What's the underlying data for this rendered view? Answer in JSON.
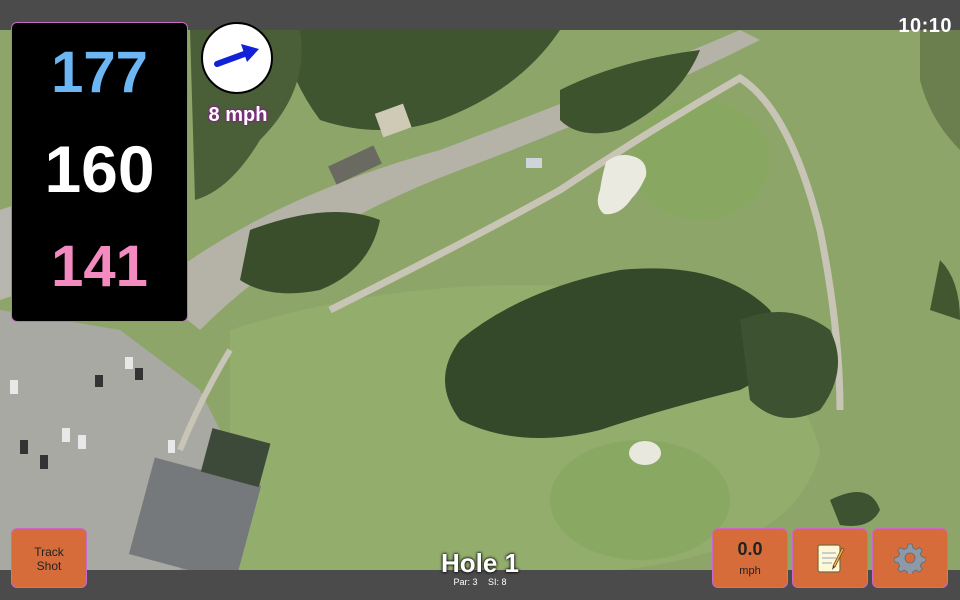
{
  "status": {
    "clock": "10:10"
  },
  "distances": {
    "back": "177",
    "center": "160",
    "front": "141"
  },
  "wind": {
    "speed_label": "8 mph",
    "direction_icon": "arrow-right-up-icon"
  },
  "buttons": {
    "track_shot": {
      "line1": "Track",
      "line2": "Shot"
    },
    "speed": {
      "value": "0.0",
      "unit": "mph"
    },
    "notes_icon": "notepad-icon",
    "settings_icon": "gear-icon"
  },
  "hole": {
    "title": "Hole 1",
    "par": "Par: 3",
    "si": "SI: 8"
  },
  "colors": {
    "back": "#6db6f4",
    "center": "#ffffff",
    "front": "#f38bc0",
    "button": "#d66c3a",
    "border_accent": "#c76ac9"
  }
}
